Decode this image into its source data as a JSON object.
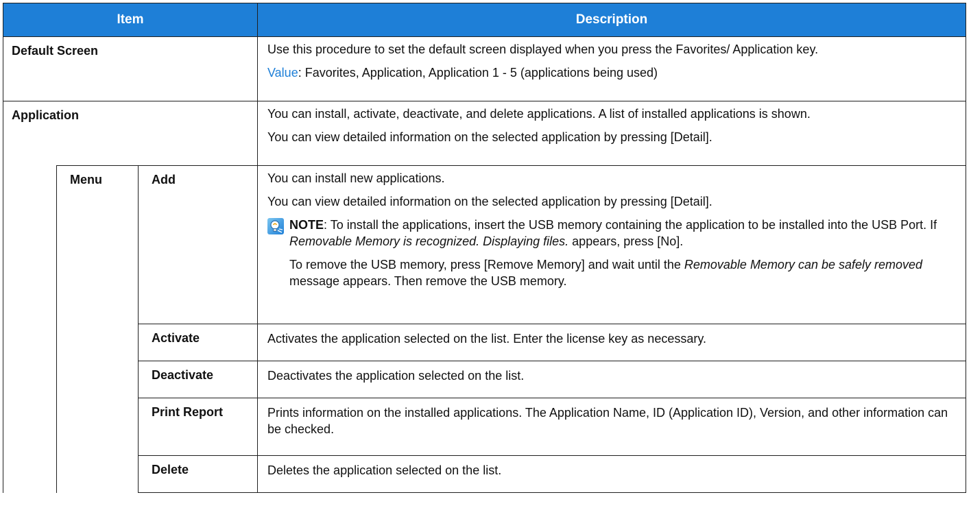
{
  "header": {
    "item": "Item",
    "description": "Description"
  },
  "default_screen": {
    "name": "Default Screen",
    "desc": "Use this procedure to set the default screen displayed when you press the Favorites/ Application key.",
    "value_label": "Value",
    "value_text": ": Favorites, Application, Application 1 - 5 (applications being used)"
  },
  "application": {
    "name": "Application",
    "desc1": "You can install, activate, deactivate, and delete applications. A list of installed applications is shown.",
    "desc2": "You can view detailed information on the selected application by pressing [Detail]."
  },
  "menu": {
    "label": "Menu",
    "add": {
      "name": "Add",
      "desc1": "You can install new applications.",
      "desc2": "You can view detailed information on the selected application by pressing [Detail].",
      "note_label": "NOTE",
      "note_part1": ": To install the applications, insert the USB memory containing the application to be installed into the USB Port. If ",
      "note_italic": "Removable Memory is recognized. Displaying files.",
      "note_part2": " appears, press [No].",
      "note2_part1": "To remove the USB memory, press [Remove Memory] and wait until the ",
      "note2_italic": "Removable Memory can be safely removed",
      "note2_part2": " message appears. Then remove the USB memory."
    },
    "activate": {
      "name": "Activate",
      "desc": "Activates the application selected on the list. Enter the license key as necessary."
    },
    "deactivate": {
      "name": "Deactivate",
      "desc": "Deactivates the application selected on the list."
    },
    "print_report": {
      "name": "Print Report",
      "desc": "Prints information on the installed applications. The Application Name, ID (Application ID), Version, and other information can be checked."
    },
    "delete": {
      "name": "Delete",
      "desc": "Deletes the application selected on the list."
    }
  },
  "colors": {
    "header_bg": "#1e7fd7",
    "value_label": "#1e7fd7",
    "note_icon": "#3aa0e0"
  },
  "icons": {
    "note": "lightbulb-note-icon"
  }
}
